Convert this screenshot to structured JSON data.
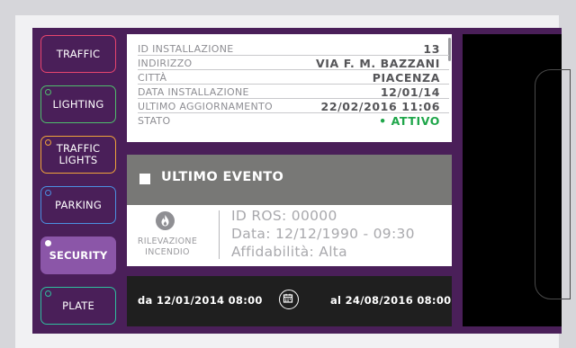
{
  "sidebar": {
    "items": [
      {
        "label": "TRAFFIC",
        "color": "#e8456e",
        "active": false
      },
      {
        "label": "LIGHTING",
        "color": "#4fbe6c",
        "active": false
      },
      {
        "label": "TRAFFIC\nLIGHTS",
        "color": "#f0a43a",
        "active": false
      },
      {
        "label": "PARKING",
        "color": "#4b8fe0",
        "active": false
      },
      {
        "label": "SECURITY",
        "color": "#8b56a8",
        "active": true
      },
      {
        "label": "PLATE",
        "color": "#2fbf9e",
        "active": false
      }
    ]
  },
  "info": {
    "rows": [
      {
        "label": "ID INSTALLAZIONE",
        "value": "13"
      },
      {
        "label": "INDIRIZZO",
        "value": "VIA F. M. BAZZANI"
      },
      {
        "label": "CITTÀ",
        "value": "PIACENZA"
      },
      {
        "label": "DATA INSTALLAZIONE",
        "value": "12/01/14"
      },
      {
        "label": "ULTIMO AGGIORNAMENTO",
        "value": "22/02/2016 11:06"
      },
      {
        "label": "STATO",
        "value": "• ATTIVO"
      }
    ],
    "status_color": "#1fa64a"
  },
  "event": {
    "title": "ULTIMO EVENTO",
    "type_line1": "RILEVAZIONE",
    "type_line2": "INCENDIO",
    "icon": "flame-icon",
    "id_ros": "ID ROS: 00000",
    "date": "Data: 12/12/1990 - 09:30",
    "reliability": "Affidabilità: Alta"
  },
  "date_range": {
    "from": "da 12/01/2014 08:00",
    "to": "al 24/08/2016 08:00",
    "icon": "calendar-icon"
  },
  "colors": {
    "panel_bg": "#4a1f59",
    "active_item": "#8b56a8"
  }
}
